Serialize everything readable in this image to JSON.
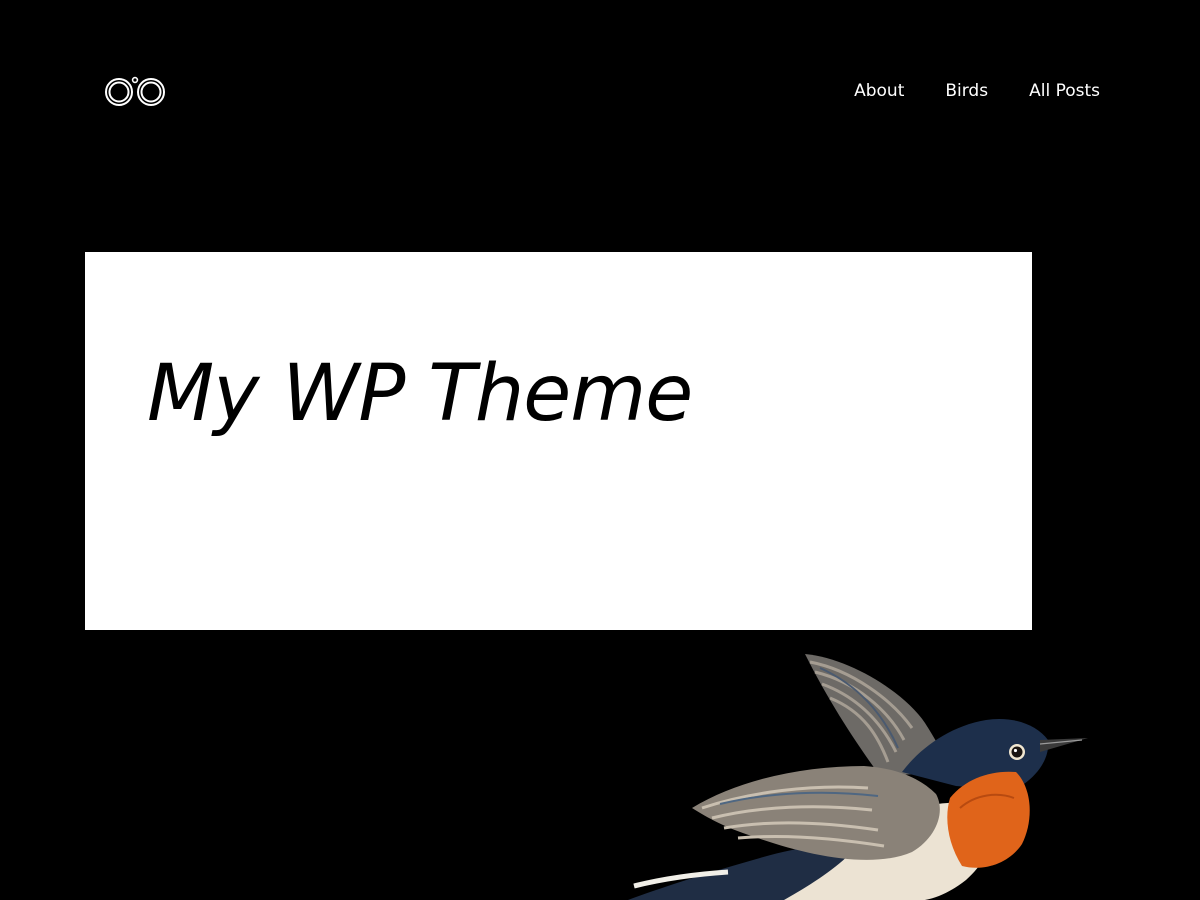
{
  "header": {
    "logo_icon": "binoculars-icon",
    "nav": {
      "about": "About",
      "birds": "Birds",
      "all_posts": "All Posts"
    }
  },
  "hero": {
    "title": "My WP Theme"
  },
  "decoration": {
    "icon": "bird-illustration"
  },
  "colors": {
    "background": "#000000",
    "text": "#ffffff",
    "hero_background": "#ffffff",
    "hero_text": "#000000",
    "bird_throat": "#e0641a"
  }
}
